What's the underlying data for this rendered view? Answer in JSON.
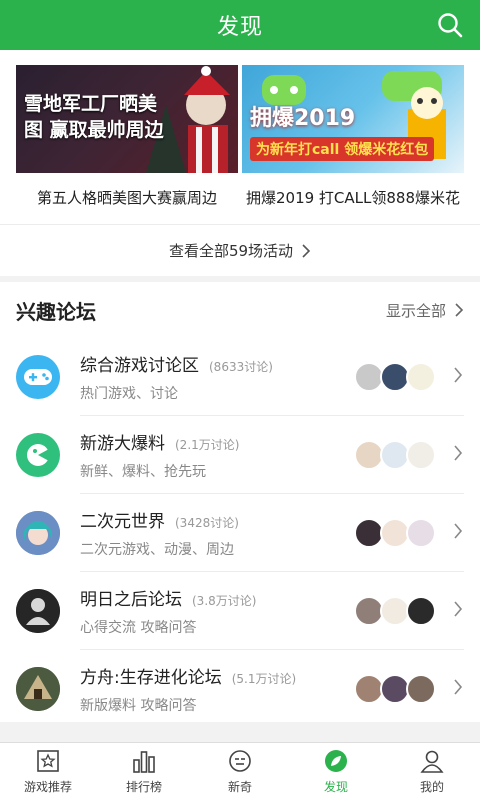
{
  "header": {
    "title": "发现"
  },
  "banners": [
    {
      "overlay": "雪地军工厂晒美图 赢取最帅周边",
      "caption": "第五人格晒美图大赛赢周边"
    },
    {
      "overlay": "拥爆2019",
      "overlay_sub": "为新年打call 领爆米花红包",
      "caption": "拥爆2019 打CALL领888爆米花"
    }
  ],
  "activities": {
    "label": "查看全部59场活动"
  },
  "forums": {
    "title": "兴趣论坛",
    "show_all": "显示全部",
    "items": [
      {
        "name": "综合游戏讨论区",
        "count": "(8633讨论)",
        "desc": "热门游戏、讨论",
        "icon": "gamepad-icon"
      },
      {
        "name": "新游大爆料",
        "count": "(2.1万讨论)",
        "desc": "新鲜、爆料、抢先玩",
        "icon": "game-cartridge-icon"
      },
      {
        "name": "二次元世界",
        "count": "(3428讨论)",
        "desc": "二次元游戏、动漫、周边",
        "icon": "anime-avatar-icon"
      },
      {
        "name": "明日之后论坛",
        "count": "(3.8万讨论)",
        "desc": "心得交流 攻略问答",
        "icon": "survivor-icon"
      },
      {
        "name": "方舟:生存进化论坛",
        "count": "(5.1万讨论)",
        "desc": "新版爆料 攻略问答",
        "icon": "ark-icon"
      }
    ]
  },
  "tabs": [
    {
      "label": "游戏推荐",
      "icon": "star-box-icon"
    },
    {
      "label": "排行榜",
      "icon": "bar-chart-icon"
    },
    {
      "label": "新奇",
      "icon": "smile-face-icon"
    },
    {
      "label": "发现",
      "icon": "compass-leaf-icon",
      "active": true
    },
    {
      "label": "我的",
      "icon": "user-icon"
    }
  ],
  "colors": {
    "brand": "#2bb24c"
  }
}
